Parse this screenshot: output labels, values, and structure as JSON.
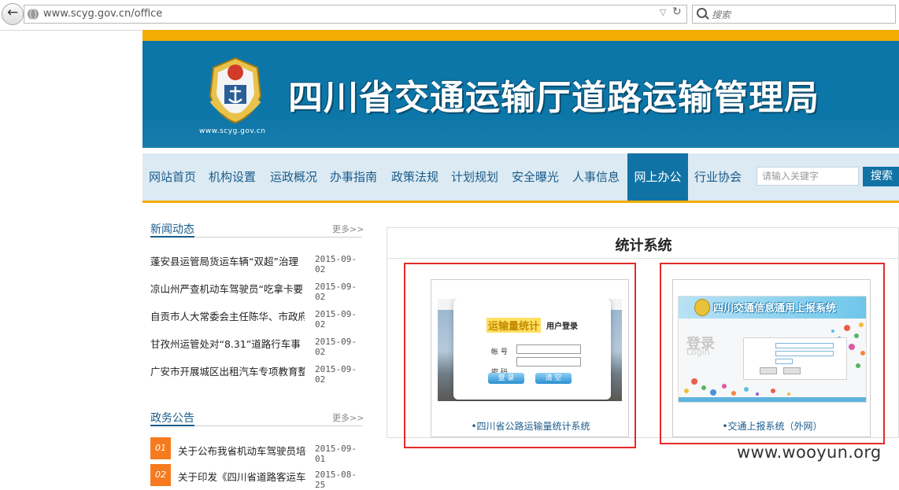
{
  "browser": {
    "url": "www.scyg.gov.cn/office",
    "search_placeholder": "搜索"
  },
  "header": {
    "site_domain": "www.scyg.gov.cn",
    "title": "四川省交通运输厅道路运输管理局"
  },
  "nav": {
    "items": [
      "网站首页",
      "机构设置",
      "运政概况",
      "办事指南",
      "政策法规",
      "计划规划",
      "安全曝光",
      "人事信息",
      "网上办公",
      "行业协会"
    ],
    "active": "网上办公",
    "search_placeholder": "请输入关键字",
    "search_button": "搜索"
  },
  "news": {
    "title": "新闻动态",
    "more": "更多>>",
    "items": [
      {
        "title": "蓬安县运管局货运车辆“双超”治理",
        "date": "2015-09-02"
      },
      {
        "title": "凉山州严查机动车驾驶员“吃拿卡要",
        "date": "2015-09-02"
      },
      {
        "title": "自贡市人大常委会主任陈华、市政府",
        "date": "2015-09-02"
      },
      {
        "title": "甘孜州运管处对“8.31”道路行车事",
        "date": "2015-09-02"
      },
      {
        "title": "广安市开展城区出租汽车专项教育整",
        "date": "2015-09-02"
      }
    ]
  },
  "notice": {
    "title": "政务公告",
    "more": "更多>>",
    "items": [
      {
        "num": "01",
        "title": "关于公布我省机动车驾驶员培",
        "date": "2015-09-01"
      },
      {
        "num": "02",
        "title": "关于印发《四川省道路客运车",
        "date": "2015-08-25"
      }
    ]
  },
  "stats": {
    "title": "统计系统",
    "cards": [
      {
        "link": "•四川省公路运输量统计系统",
        "thumb": {
          "logo": "运输量统计",
          "subtitle": "用户登录",
          "label_account": "帐 号",
          "label_password": "密 码",
          "btn_login": "登 录",
          "btn_clear": "清 空"
        }
      },
      {
        "link": "•交通上报系统（外网）",
        "thumb": {
          "header": "四川交通信息通用上报系统",
          "login": "登录",
          "login_en": "Login"
        }
      }
    ]
  },
  "watermark": "www.wooyun.org",
  "colors": {
    "accent_orange": "#f2ad00",
    "banner_blue": "#0c76a8",
    "nav_active": "#1173a5",
    "highlight_red": "#e52a2a"
  }
}
